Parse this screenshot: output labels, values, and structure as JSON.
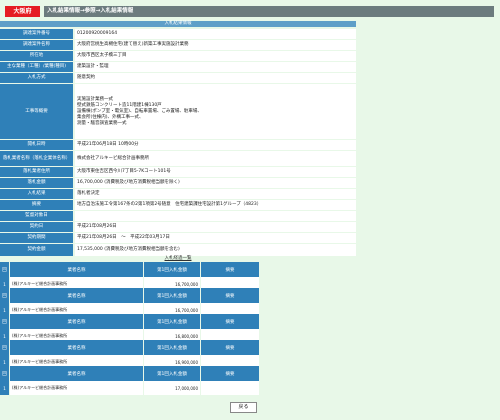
{
  "header": {
    "org_badge": "大阪府",
    "breadcrumb": "入札結果情報→参照→入札結果情報"
  },
  "detail": {
    "title": "入札結果情報",
    "rows": [
      {
        "label": "調達案件番号",
        "lines": [
          "01200920009164"
        ]
      },
      {
        "label": "調達案件名称",
        "lines": [
          "大阪府営桃生高槻住宅(建て替え)新築工事実施設計業務"
        ]
      },
      {
        "label": "所在地",
        "lines": [
          "大阪市西区太子橋三丁目"
        ]
      },
      {
        "label": "主な業種（工種）/業種(種目)",
        "lines": [
          "建築設計・監理"
        ]
      },
      {
        "label": "入札方式",
        "lines": [
          "随意契約"
        ]
      },
      {
        "label": "工事等概要",
        "lines": [
          "実施設計業務一式",
          "壁式鉄筋コンクリート造11階建1棟130戸",
          "設備棟(ポンプ室・電気室)、自転車置場、ごみ置場、駐車場、",
          "集会所(住棟内)、外構工事一式、",
          "測量・騒音調査業務一式"
        ]
      },
      {
        "label": "開札日時",
        "lines": [
          "平成21年06月18日 10時00分"
        ]
      },
      {
        "label": "落札業者名称（落札企業体名称）",
        "lines": [
          "株式会社アルキービ総合計画事務所"
        ]
      },
      {
        "label": "落札業者住所",
        "lines": [
          "大阪市東住吉区西今川7丁目5-7Kコート101号"
        ]
      },
      {
        "label": "落札金額",
        "lines": [
          "16,700,000 (消費税及び地方消費税相当額を除く)"
        ]
      },
      {
        "label": "入札結果",
        "lines": [
          "落札者決定"
        ]
      },
      {
        "label": "摘要",
        "lines": [
          "地方自治法施工令第167条の2第1項第2号随意　住宅建築課住宅設計第1グループ（4823）"
        ]
      },
      {
        "label": "監督対象日",
        "lines": [
          ""
        ]
      },
      {
        "label": "契約日",
        "lines": [
          "平成21年08月26日"
        ]
      },
      {
        "label": "契約期間",
        "lines": [
          "平成21年08月26日　～　平成22年03月17日"
        ]
      },
      {
        "label": "契約金額",
        "lines": [
          "17,535,000 (消費税及び地方消費税相当額を含む)"
        ]
      }
    ]
  },
  "list": {
    "title": "入札経過一覧",
    "headers": [
      "回",
      "業者名称",
      "第1回入札金額",
      "摘要"
    ],
    "groups": [
      {
        "no": "1",
        "name": "(株)アルキービ総合計画事務所",
        "amount": "16,700,000",
        "note": ""
      },
      {
        "no": "1",
        "name": "(株)アルキービ総合計画事務所",
        "amount": "16,700,000",
        "note": ""
      },
      {
        "no": "1",
        "name": "(株)アルキービ総合計画事務所",
        "amount": "16,800,000",
        "note": ""
      },
      {
        "no": "1",
        "name": "(株)アルキービ総合計画事務所",
        "amount": "16,900,000",
        "note": ""
      },
      {
        "no": "1",
        "name": "(株)アルキービ総合計画事務所",
        "amount": "17,000,000",
        "note": ""
      }
    ]
  },
  "back_button": "戻る"
}
